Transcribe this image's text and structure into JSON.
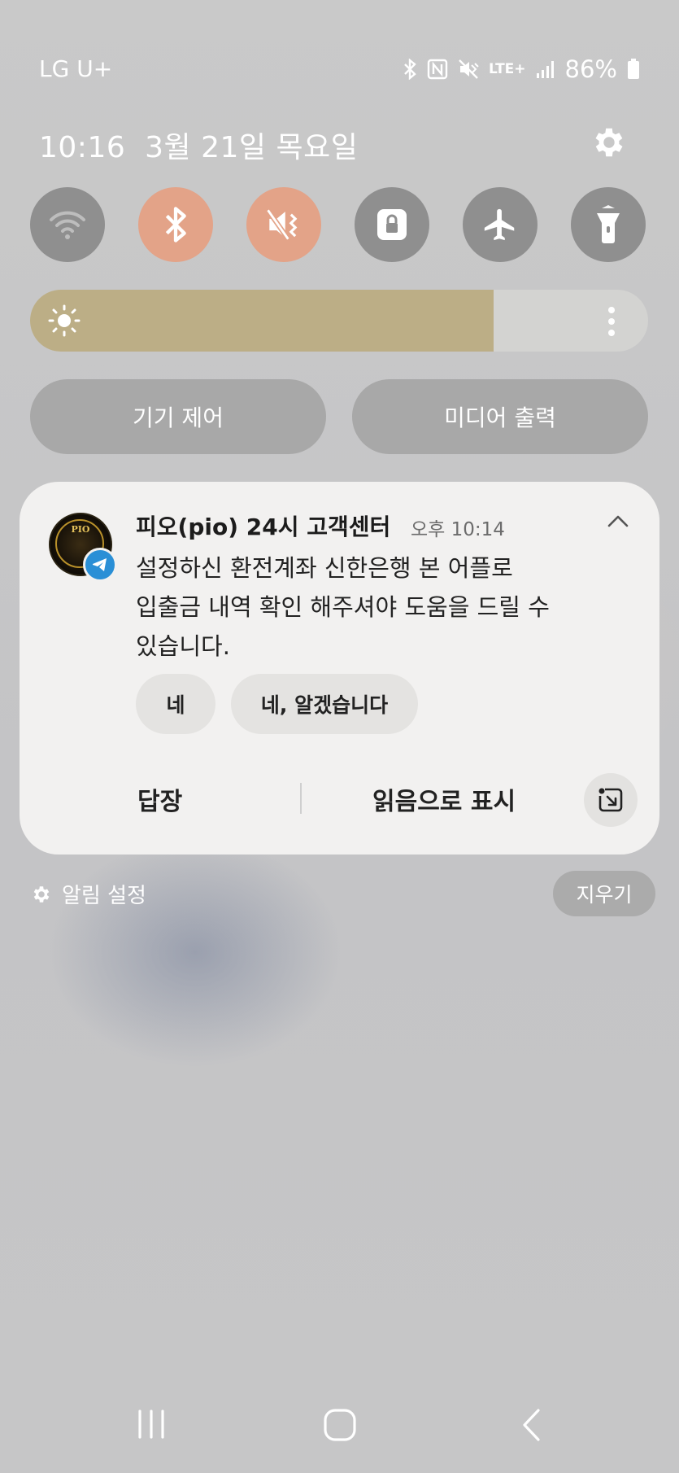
{
  "status_bar": {
    "carrier": "LG U+",
    "network": "LTE+",
    "battery": "86%"
  },
  "header": {
    "time": "10:16",
    "date": "3월 21일 목요일"
  },
  "quick_settings": [
    {
      "name": "wifi",
      "state": "off"
    },
    {
      "name": "bluetooth",
      "state": "on"
    },
    {
      "name": "mute",
      "state": "on"
    },
    {
      "name": "screen-lock",
      "state": "off"
    },
    {
      "name": "airplane",
      "state": "off"
    },
    {
      "name": "flashlight",
      "state": "off"
    }
  ],
  "brightness": {
    "level": 0.75
  },
  "panel_buttons": {
    "device_control": "기기 제어",
    "media_output": "미디어 출력"
  },
  "notification": {
    "app_icon": "telegram-icon",
    "avatar_text": "PIO",
    "title": "피오(pio) 24시 고객센터",
    "time": "오후 10:14",
    "body": "설정하신 환전계좌 신한은행 본 어플로\n입출금 내역 확인 해주셔야 도움을 드릴 수\n있습니다.",
    "quick_replies": [
      "네",
      "네, 알겠습니다"
    ],
    "actions": {
      "reply": "답장",
      "mark_read": "읽음으로 표시"
    }
  },
  "footer": {
    "notification_settings": "알림 설정",
    "clear": "지우기"
  },
  "colors": {
    "toggle_on": "#e3a388",
    "toggle_off": "#8f8f8f",
    "brightness_fill": "#bcae86",
    "telegram": "#2a8fd6"
  }
}
